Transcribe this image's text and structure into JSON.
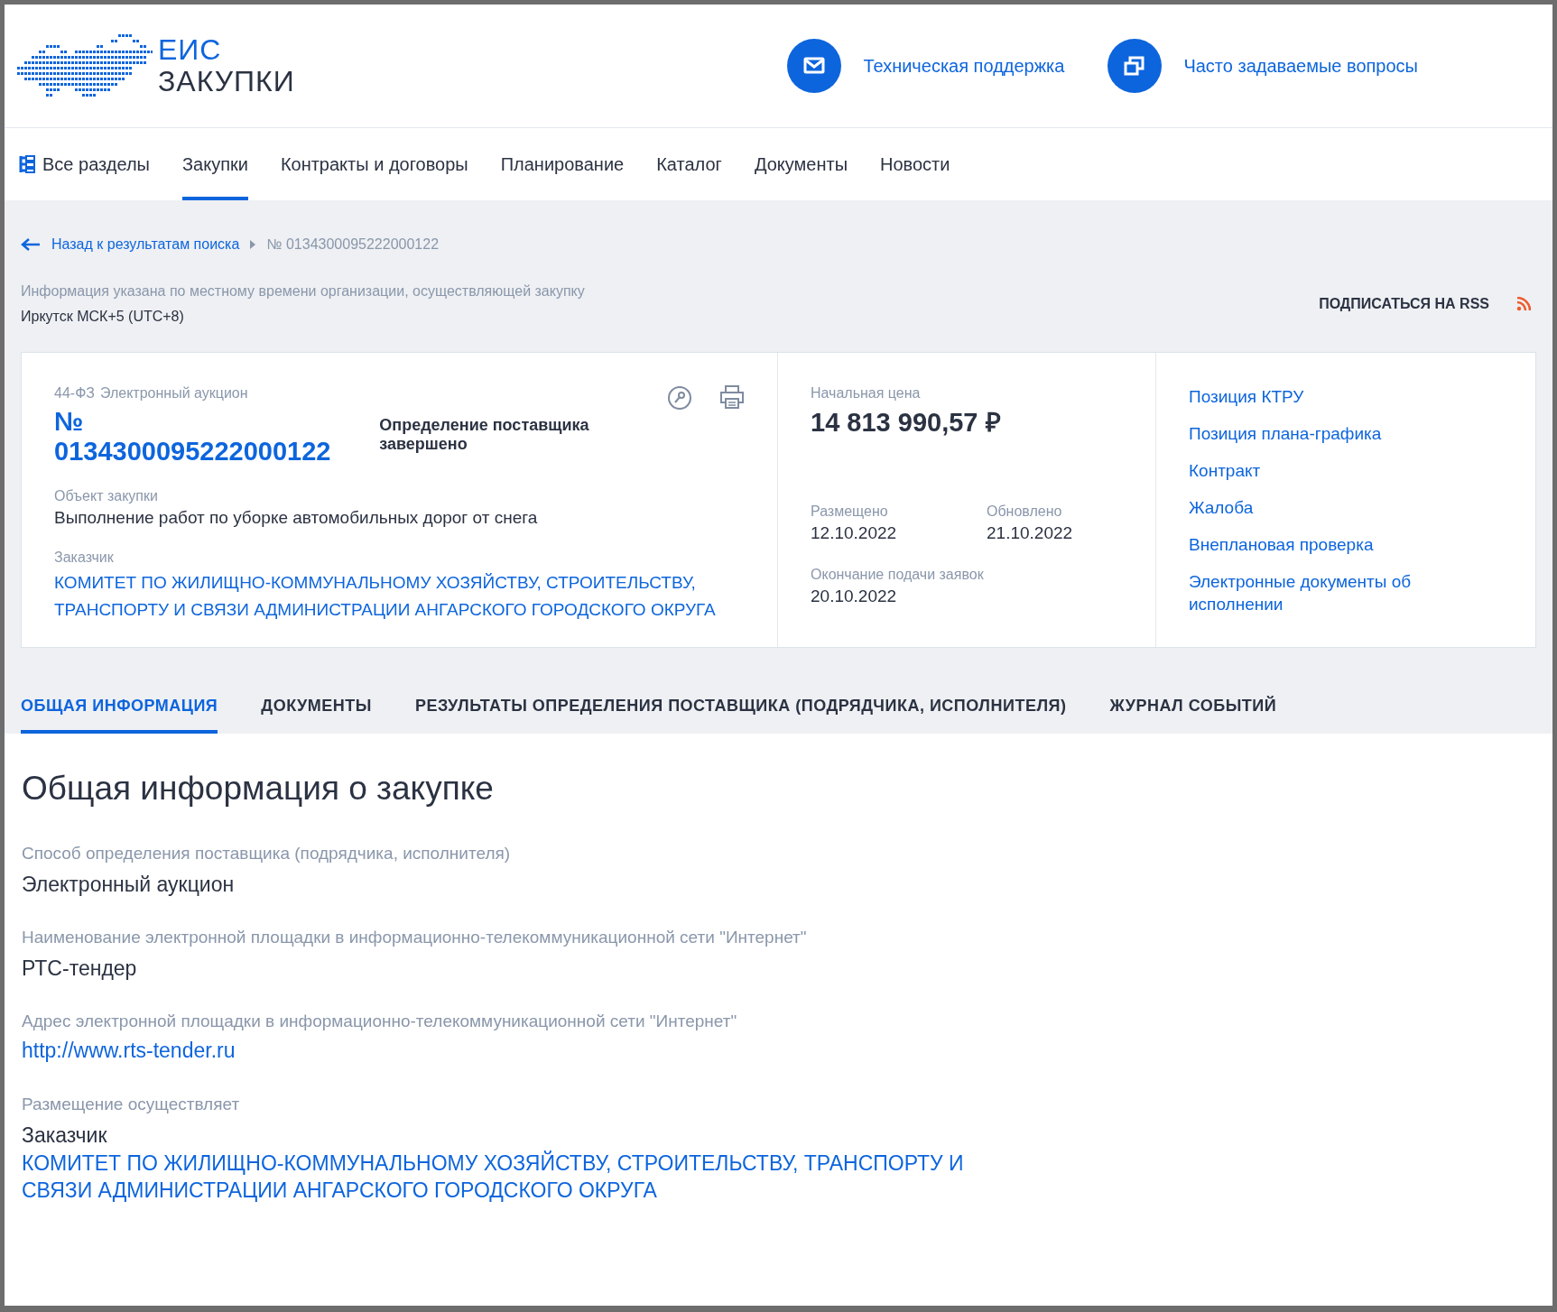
{
  "header": {
    "logo_line1": "ЕИС",
    "logo_line2": "ЗАКУПКИ",
    "links": [
      {
        "label": "Техническая поддержка",
        "kind": "mail"
      },
      {
        "label": "Часто задаваемые вопросы",
        "kind": "windows"
      }
    ]
  },
  "nav": [
    {
      "label": "Все разделы",
      "kind": "sections",
      "selected": false
    },
    {
      "label": "Закупки",
      "kind": "plain",
      "selected": true
    },
    {
      "label": "Контракты и договоры",
      "kind": "plain",
      "selected": false
    },
    {
      "label": "Планирование",
      "kind": "plain",
      "selected": false
    },
    {
      "label": "Каталог",
      "kind": "plain",
      "selected": false
    },
    {
      "label": "Документы",
      "kind": "plain",
      "selected": false
    },
    {
      "label": "Новости",
      "kind": "plain",
      "selected": false
    }
  ],
  "breadcrumb": {
    "back": "Назад к результатам поиска",
    "current": "№ 0134300095222000122"
  },
  "timezone": {
    "note": "Информация указана по местному времени организации, осуществляющей закупку",
    "value": "Иркутск МСК+5 (UTC+8)"
  },
  "rss": "ПОДПИСАТЬСЯ НА RSS",
  "card": {
    "law": "44-ФЗ",
    "method": "Электронный аукцион",
    "number": "№ 0134300095222000122",
    "status": "Определение поставщика завершено",
    "object_label": "Объект закупки",
    "object": "Выполнение работ по уборке автомобильных дорог от снега",
    "customer_label": "Заказчик",
    "customer": "КОМИТЕТ ПО ЖИЛИЩНО-КОММУНАЛЬНОМУ ХОЗЯЙСТВУ, СТРОИТЕЛЬСТВУ, ТРАНСПОРТУ И СВЯЗИ АДМИНИСТРАЦИИ АНГАРСКОГО ГОРОДСКОГО ОКРУГА",
    "price_label": "Начальная цена",
    "price": "14 813 990,57 ₽",
    "dates": [
      {
        "label": "Размещено",
        "value": "12.10.2022"
      },
      {
        "label": "Обновлено",
        "value": "21.10.2022"
      },
      {
        "label": "Окончание подачи заявок",
        "value": "20.10.2022"
      }
    ],
    "links": [
      "Позиция КТРУ",
      "Позиция плана-графика",
      "Контракт",
      "Жалоба",
      "Внеплановая проверка",
      "Электронные документы об исполнении"
    ]
  },
  "tabs": [
    {
      "label": "ОБЩАЯ ИНФОРМАЦИЯ",
      "selected": true
    },
    {
      "label": "ДОКУМЕНТЫ",
      "selected": false
    },
    {
      "label": "РЕЗУЛЬТАТЫ ОПРЕДЕЛЕНИЯ ПОСТАВЩИКА (ПОДРЯДЧИКА, ИСПОЛНИТЕЛЯ)",
      "selected": false
    },
    {
      "label": "ЖУРНАЛ СОБЫТИЙ",
      "selected": false
    }
  ],
  "section": {
    "title": "Общая информация о закупке",
    "fields": [
      {
        "label": "Способ определения поставщика (подрядчика, исполнителя)",
        "value": "Электронный аукцион"
      },
      {
        "label": "Наименование электронной площадки в информационно-телекоммуникационной сети \"Интернет\"",
        "value": "РТС-тендер"
      },
      {
        "label": "Адрес электронной площадки в информационно-телекоммуникационной сети \"Интернет\"",
        "link": "http://www.rts-tender.ru"
      },
      {
        "label": "Размещение осуществляет",
        "value": "Заказчик",
        "link": "КОМИТЕТ ПО ЖИЛИЩНО-КОММУНАЛЬНОМУ ХОЗЯЙСТВУ, СТРОИТЕЛЬСТВУ, ТРАНСПОРТУ И СВЯЗИ АДМИНИСТРАЦИИ АНГАРСКОГО ГОРОДСКОГО ОКРУГА"
      }
    ]
  }
}
